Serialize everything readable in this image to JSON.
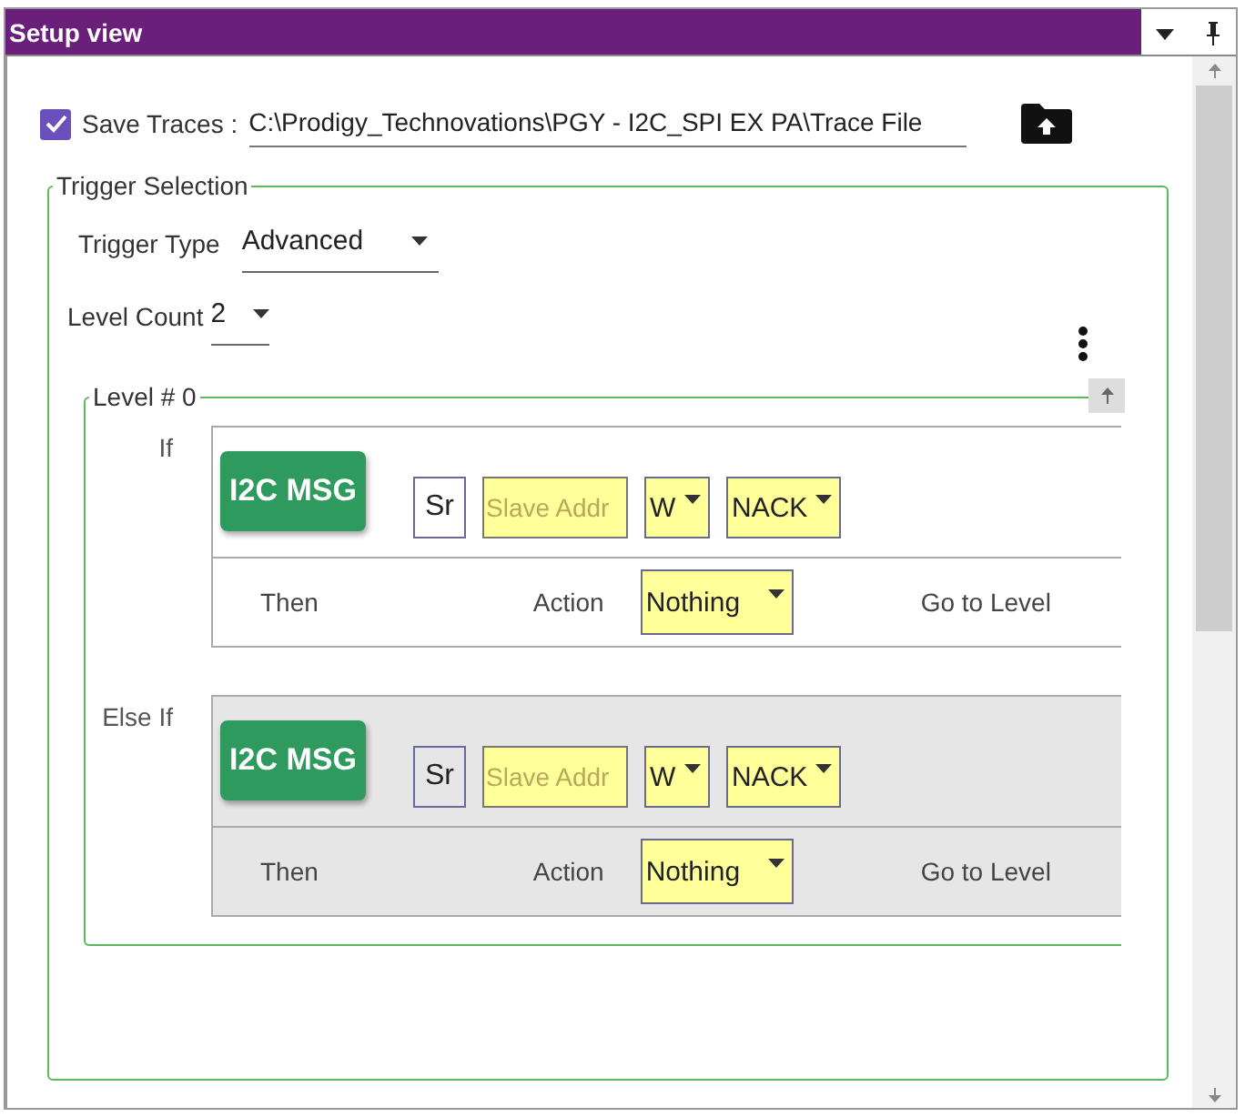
{
  "window": {
    "title": "Setup view"
  },
  "save_traces": {
    "label": "Save Traces :",
    "checked": true,
    "path": "C:\\Prodigy_Technovations\\PGY - I2C_SPI EX PA\\Trace File"
  },
  "trigger_selection": {
    "title": "Trigger Selection",
    "trigger_type": {
      "label": "Trigger Type",
      "value": "Advanced"
    },
    "level_count": {
      "label": "Level Count",
      "value": "2"
    },
    "levels": [
      {
        "title": "Level # 0",
        "clauses": [
          {
            "kind": "if",
            "condition": "If",
            "message_button": "I2C MSG",
            "start": "Sr",
            "address_placeholder": "Slave Addr",
            "direction": "W",
            "ack": "NACK",
            "then_label": "Then",
            "action_label": "Action",
            "action": "Nothing",
            "goto_label": "Go to Level"
          },
          {
            "kind": "else_if",
            "condition": "Else If",
            "message_button": "I2C MSG",
            "start": "Sr",
            "address_placeholder": "Slave Addr",
            "direction": "W",
            "ack": "NACK",
            "then_label": "Then",
            "action_label": "Action",
            "action": "Nothing",
            "goto_label": "Go to Level"
          }
        ]
      }
    ]
  }
}
